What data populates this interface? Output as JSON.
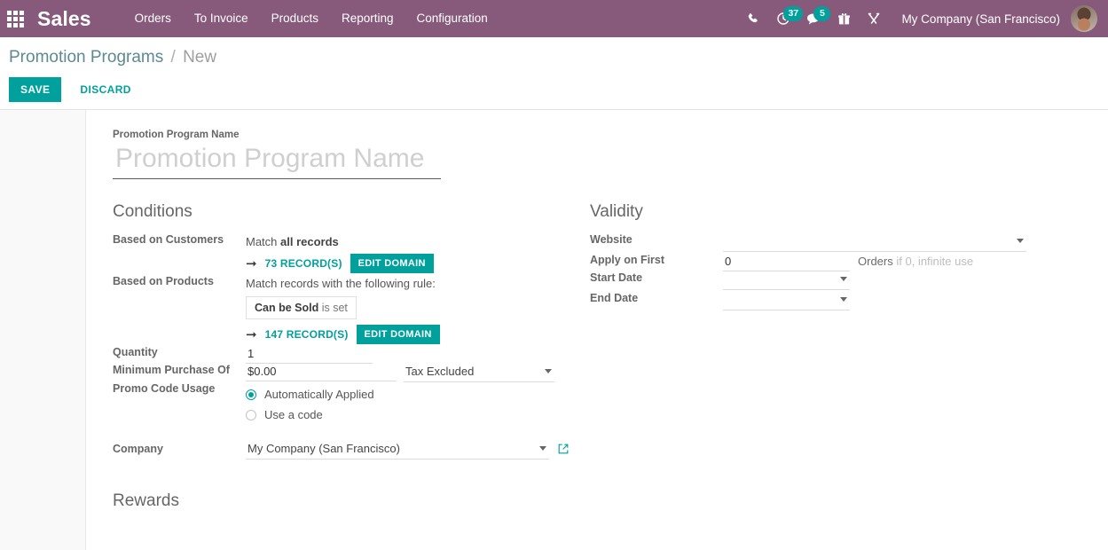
{
  "navbar": {
    "apps_icon": "apps-grid-icon",
    "brand": "Sales",
    "menu": [
      {
        "label": "Orders"
      },
      {
        "label": "To Invoice"
      },
      {
        "label": "Products"
      },
      {
        "label": "Reporting"
      },
      {
        "label": "Configuration"
      }
    ],
    "systray": {
      "phone_icon": "phone-icon",
      "activity_icon": "clock-activity-icon",
      "activity_count": "37",
      "messages_icon": "chat-messages-icon",
      "messages_count": "5",
      "gift_icon": "gift-icon",
      "tools_icon": "tools-wrench-icon",
      "company": "My Company (San Francisco)",
      "avatar": "user-avatar"
    },
    "background_color": "#875A7B",
    "accent_color": "#00A09D"
  },
  "control_panel": {
    "breadcrumb": {
      "parent": "Promotion Programs",
      "separator": "/",
      "current": "New"
    },
    "save_label": "SAVE",
    "discard_label": "DISCARD"
  },
  "form": {
    "title": {
      "label": "Promotion Program Name",
      "value": "",
      "placeholder": "Promotion Program Name"
    },
    "conditions": {
      "heading": "Conditions",
      "based_on_customers": {
        "label": "Based on Customers",
        "match_prefix": "Match ",
        "match_strong": "all records",
        "arrow_icon": "arrow-right-icon",
        "records_link": "73 RECORD(S)",
        "edit_domain_label": "EDIT DOMAIN"
      },
      "based_on_products": {
        "label": "Based on Products",
        "match_text": "Match records with the following rule:",
        "rule_field": "Can be Sold",
        "rule_operator": "is set",
        "arrow_icon": "arrow-right-icon",
        "records_link": "147 RECORD(S)",
        "edit_domain_label": "EDIT DOMAIN"
      },
      "quantity": {
        "label": "Quantity",
        "value": "1"
      },
      "minimum_purchase": {
        "label": "Minimum Purchase Of",
        "value": "$0.00",
        "tax_value": "Tax Excluded"
      },
      "promo_code_usage": {
        "label": "Promo Code Usage",
        "options": [
          {
            "label": "Automatically Applied",
            "selected": true
          },
          {
            "label": "Use a code",
            "selected": false
          }
        ]
      },
      "company": {
        "label": "Company",
        "value": "My Company (San Francisco)",
        "external_link_icon": "external-link-icon"
      }
    },
    "validity": {
      "heading": "Validity",
      "website": {
        "label": "Website",
        "value": ""
      },
      "apply_on_first": {
        "label": "Apply on First",
        "value": "0",
        "unit": "Orders",
        "hint": "if 0, infinite use"
      },
      "start_date": {
        "label": "Start Date",
        "value": ""
      },
      "end_date": {
        "label": "End Date",
        "value": ""
      }
    },
    "rewards": {
      "heading": "Rewards"
    }
  }
}
